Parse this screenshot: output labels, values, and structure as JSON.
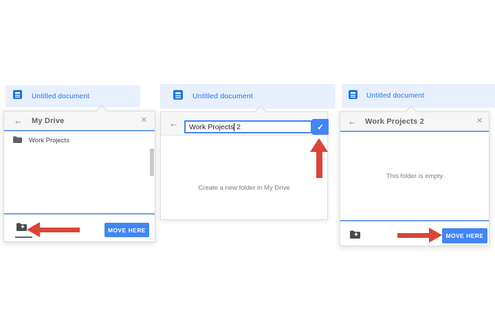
{
  "colors": {
    "accent_blue": "#4285f4",
    "doc_header_bg": "#e8f0fe",
    "doc_header_text": "#1a73e8",
    "divider_blue": "#6d9eeb",
    "annotation_red": "#db4437"
  },
  "icons": {
    "back": "←",
    "close": "✕",
    "check": "✓"
  },
  "panels": [
    {
      "header": {
        "title": "Untitled document"
      },
      "dialog": {
        "title": "My Drive",
        "folders": [
          {
            "label": "Work Projects"
          }
        ],
        "move_button_label": "MOVE HERE"
      }
    },
    {
      "header": {
        "title": "Untitled document"
      },
      "dialog": {
        "input": {
          "value": "Work Projects 2",
          "before_cursor": "Work Projects",
          "after_cursor": " 2"
        },
        "hint": "Create a new folder in My Drive"
      }
    },
    {
      "header": {
        "title": "Untitled document"
      },
      "dialog": {
        "title": "Work Projects 2",
        "empty_text": "This folder is empty",
        "move_button_label": "MOVE HERE"
      }
    }
  ]
}
